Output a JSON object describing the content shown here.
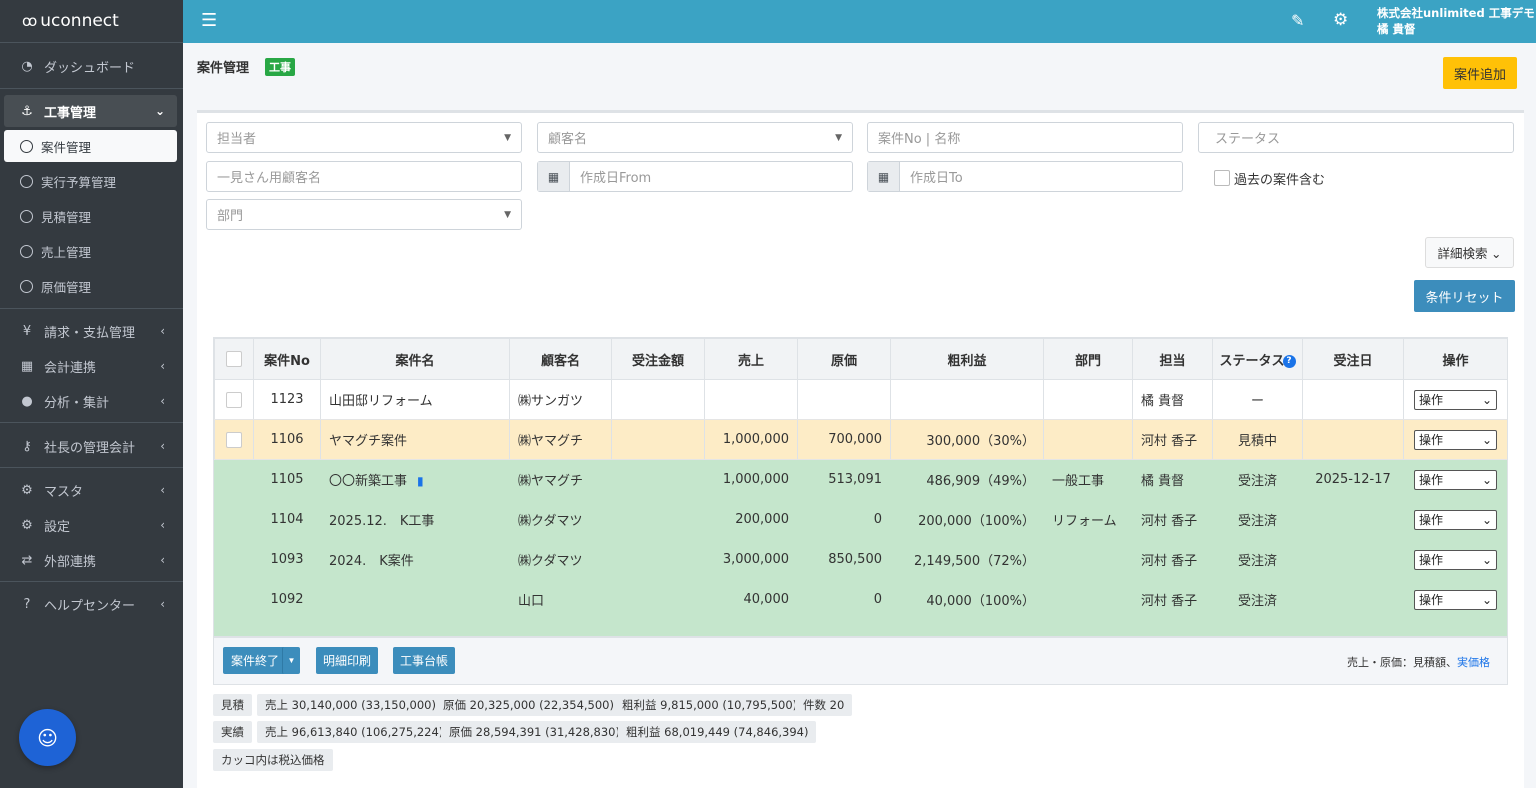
{
  "brand": "uconnect",
  "sidebar": {
    "dashboard": "ダッシュボード",
    "construction": "工事管理",
    "sub": [
      "案件管理",
      "実行予算管理",
      "見積管理",
      "売上管理",
      "原価管理"
    ],
    "billing": "請求・支払管理",
    "accounting": "会計連携",
    "analysis": "分析・集計",
    "president": "社長の管理会計",
    "master": "マスタ",
    "settings": "設定",
    "external": "外部連携",
    "help": "ヘルプセンター"
  },
  "header": {
    "company": "株式会社unlimited 工事デモ",
    "user": "橘 貴督"
  },
  "page": {
    "title": "案件管理",
    "badge": "工事",
    "add_button": "案件追加"
  },
  "filters": {
    "assignee": "担当者",
    "customer": "顧客名",
    "case_no": "案件No | 名称",
    "status": "ステータス",
    "oneoff_customer": "一見さん用顧客名",
    "date_from": "作成日From",
    "date_to": "作成日To",
    "include_past": "過去の案件含む",
    "department": "部門",
    "detail_search": "詳細検索",
    "reset": "条件リセット"
  },
  "table": {
    "headers": [
      "",
      "案件No",
      "案件名",
      "顧客名",
      "受注金額",
      "売上",
      "原価",
      "粗利益",
      "部門",
      "担当",
      "ステータス",
      "受注日",
      "操作"
    ],
    "rows": [
      {
        "no": "1123",
        "name": "山田邸リフォーム",
        "customer": "㈱サンガツ",
        "order": "",
        "sales": "",
        "cost": "",
        "profit": "",
        "dept": "",
        "staff": "橘 貴督",
        "status": "ー",
        "date": "",
        "op": "操作",
        "color": "white"
      },
      {
        "no": "1106",
        "name": "ヤマグチ案件",
        "customer": "㈱ヤマグチ",
        "order": "",
        "sales": "1,000,000",
        "cost": "700,000",
        "profit": "300,000（30%）",
        "dept": "",
        "staff": "河村 香子",
        "status": "見積中",
        "date": "",
        "op": "操作",
        "color": "yellow"
      },
      {
        "no": "1105",
        "name": "〇〇新築工事",
        "customer": "㈱ヤマグチ",
        "order": "",
        "sales": "1,000,000",
        "cost": "513,091",
        "profit": "486,909（49%）",
        "dept": "一般工事",
        "staff": "橘 貴督",
        "status": "受注済",
        "date": "2025-12-17",
        "op": "操作",
        "color": "green"
      },
      {
        "no": "1104",
        "name": "2025.12.　K工事",
        "customer": "㈱クダマツ",
        "order": "",
        "sales": "200,000",
        "cost": "0",
        "profit": "200,000（100%）",
        "dept": "リフォーム",
        "staff": "河村 香子",
        "status": "受注済",
        "date": "",
        "op": "操作",
        "color": "green"
      },
      {
        "no": "1093",
        "name": "2024.　K案件",
        "customer": "㈱クダマツ",
        "order": "",
        "sales": "3,000,000",
        "cost": "850,500",
        "profit": "2,149,500（72%）",
        "dept": "",
        "staff": "河村 香子",
        "status": "受注済",
        "date": "",
        "op": "操作",
        "color": "green"
      },
      {
        "no": "1092",
        "name": "",
        "customer": "山口",
        "order": "",
        "sales": "40,000",
        "cost": "0",
        "profit": "40,000（100%）",
        "dept": "",
        "staff": "河村 香子",
        "status": "受注済",
        "date": "",
        "op": "操作",
        "color": "green"
      }
    ]
  },
  "actions": {
    "close": "案件終了",
    "print": "明細印刷",
    "ledger": "工事台帳",
    "note_prefix": "売上・原価：見積額、",
    "note_link": "実価格"
  },
  "summary": {
    "estimate_label": "見積",
    "estimate_sales": "売上 30,140,000 (33,150,000)",
    "estimate_cost": "原価 20,325,000 (22,354,500)",
    "estimate_profit": "粗利益 9,815,000 (10,795,500)",
    "count": "件数 20",
    "actual_label": "実績",
    "actual_sales": "売上 96,613,840 (106,275,224)",
    "actual_cost": "原価 28,594,391 (31,428,830)",
    "actual_profit": "粗利益 68,019,449 (74,846,394)",
    "tax_note": "カッコ内は税込価格"
  }
}
